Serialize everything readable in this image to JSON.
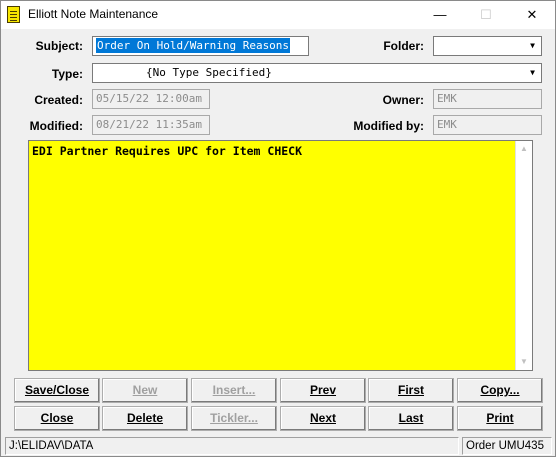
{
  "window": {
    "title": "Elliott Note Maintenance",
    "minimize": "—",
    "maximize": "☐",
    "close": "✕"
  },
  "form": {
    "subject_label": "Subject:",
    "subject_value": "Order On Hold/Warning Reasons",
    "folder_label": "Folder:",
    "folder_value": "",
    "type_label": "Type:",
    "type_value": "{No Type Specified}",
    "created_label": "Created:",
    "created_value": "05/15/22 12:00am",
    "owner_label": "Owner:",
    "owner_value": "EMK",
    "modified_label": "Modified:",
    "modified_value": "08/21/22 11:35am",
    "modified_by_label": "Modified by:",
    "modified_by_value": "EMK"
  },
  "note": {
    "text": "EDI Partner Requires UPC for Item CHECK",
    "background": "#ffff00"
  },
  "buttons": {
    "save_close": "Save/Close",
    "new": "New",
    "insert": "Insert...",
    "prev": "Prev",
    "first": "First",
    "copy": "Copy...",
    "close": "Close",
    "delete": "Delete",
    "tickler": "Tickler...",
    "next": "Next",
    "last": "Last",
    "print": "Print"
  },
  "statusbar": {
    "path": "J:\\ELIDAV\\DATA",
    "order": "Order UMU435"
  },
  "icons": {
    "app": "note-pad-icon",
    "dropdown": "chevron-down-icon",
    "scroll_up": "arrow-up-icon",
    "scroll_down": "arrow-down-icon"
  }
}
